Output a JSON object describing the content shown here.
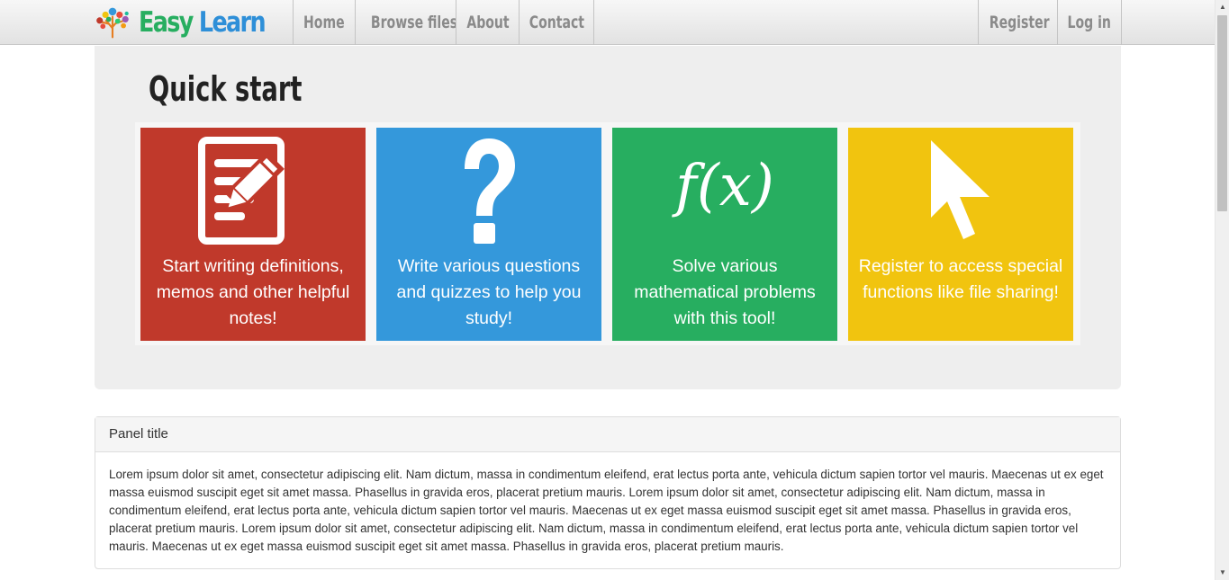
{
  "brand": {
    "part1": "Easy",
    "part2": "Learn"
  },
  "nav": {
    "home": "Home",
    "browse": "Browse files",
    "about": "About",
    "contact": "Contact",
    "register": "Register",
    "login": "Log in"
  },
  "jumbotron": {
    "title": "Quick start",
    "tiles": [
      {
        "text": "Start writing definitions, memos and other helpful notes!",
        "color": "#c0392b",
        "icon": "notepad-pencil-icon"
      },
      {
        "text": "Write various questions and quizzes to help you study!",
        "color": "#3498db",
        "icon": "question-mark-icon"
      },
      {
        "text": "Solve various mathematical problems with this tool!",
        "color": "#27ae60",
        "icon": "function-icon",
        "icon_text": "f(x)"
      },
      {
        "text": "Register to access special functions like file sharing!",
        "color": "#f1c40f",
        "icon": "cursor-arrow-icon"
      }
    ]
  },
  "panel": {
    "title": "Panel title",
    "body": "Lorem ipsum dolor sit amet, consectetur adipiscing elit. Nam dictum, massa in condimentum eleifend, erat lectus porta ante, vehicula dictum sapien tortor vel mauris. Maecenas ut ex eget massa euismod suscipit eget sit amet massa. Phasellus in gravida eros, placerat pretium mauris. Lorem ipsum dolor sit amet, consectetur adipiscing elit. Nam dictum, massa in condimentum eleifend, erat lectus porta ante, vehicula dictum sapien tortor vel mauris. Maecenas ut ex eget massa euismod suscipit eget sit amet massa. Phasellus in gravida eros, placerat pretium mauris. Lorem ipsum dolor sit amet, consectetur adipiscing elit. Nam dictum, massa in condimentum eleifend, erat lectus porta ante, vehicula dictum sapien tortor vel mauris. Maecenas ut ex eget massa euismod suscipit eget sit amet massa. Phasellus in gravida eros, placerat pretium mauris."
  },
  "colors": {
    "brand_green": "#27ae60",
    "brand_blue": "#2e8fd8",
    "tile_red": "#c0392b",
    "tile_blue": "#3498db",
    "tile_green": "#27ae60",
    "tile_yellow": "#f1c40f"
  }
}
